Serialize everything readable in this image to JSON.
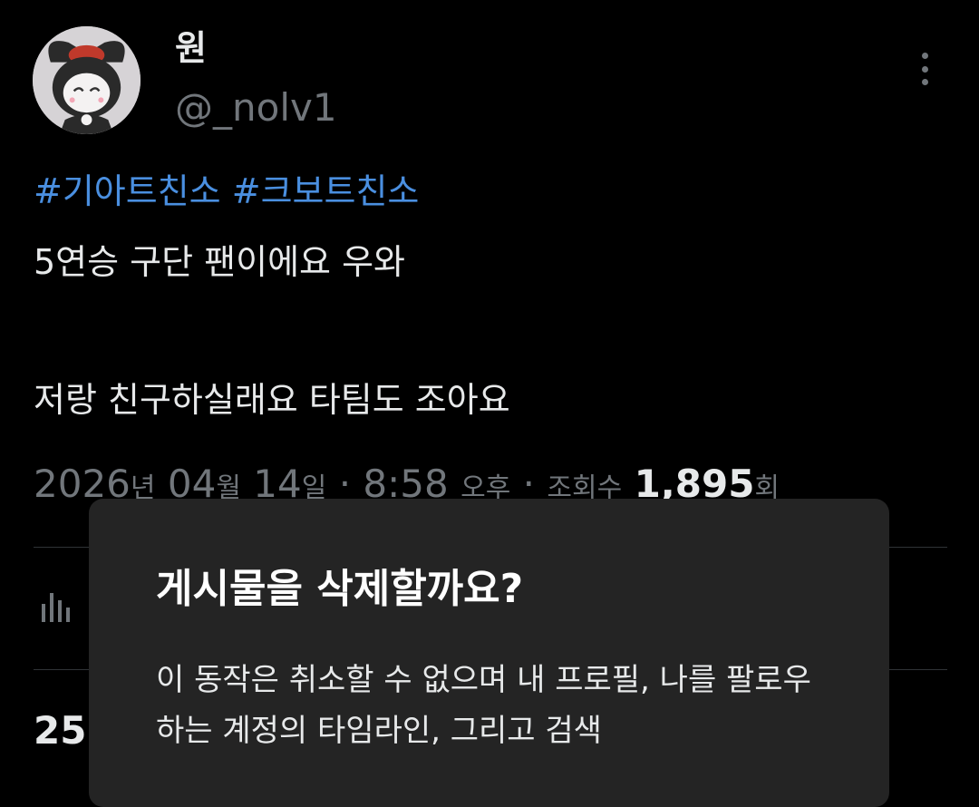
{
  "header": {
    "display_name": "원",
    "handle": "@_nolv1",
    "more_icon": "more-vertical-icon"
  },
  "post": {
    "hashtags": [
      "#기아트친소",
      "#크보트친소"
    ],
    "line1": "5연승 구단 팬이에요 우와",
    "line2": "저랑 친구하실래요 타팀도 조아요"
  },
  "meta": {
    "date": "2026",
    "year_unit": "년",
    "month": "04",
    "month_unit": "월",
    "day": "14",
    "day_unit": "일",
    "sep1": "·",
    "time": "8:58",
    "ampm": "오후",
    "sep2": "·",
    "views_label": "조회수",
    "views_count": "1,895",
    "views_unit": "회"
  },
  "actions": {
    "analytics_icon": "analytics-icon"
  },
  "stats": {
    "partial_count": "25"
  },
  "dialog": {
    "title": "게시물을 삭제할까요?",
    "body": "이 동작은 취소할 수 없으며 내 프로필, 나를 팔로우하는 계정의 타임라인, 그리고 검색"
  },
  "colors": {
    "background": "#000000",
    "hashtag": "#4a8fe0",
    "muted": "#71767b",
    "dialog_bg": "#242424"
  }
}
